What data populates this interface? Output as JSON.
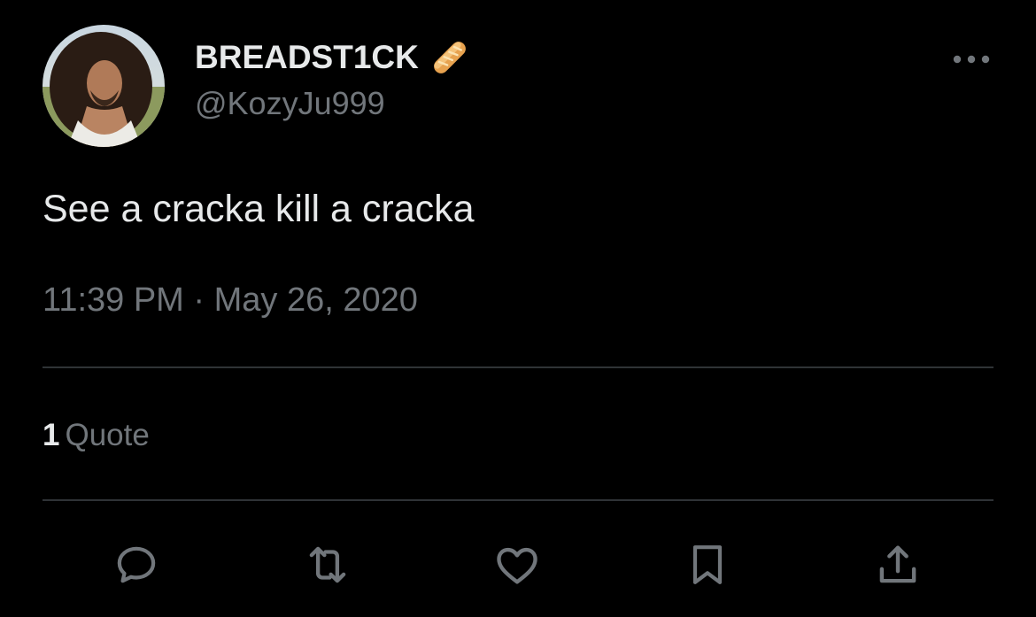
{
  "author": {
    "display_name": "BREADST1CK",
    "name_emoji_icon": "baguette-bread-icon",
    "handle": "@KozyJu999",
    "avatar_icon": "profile-photo"
  },
  "tweet": {
    "text": "See a cracka kill a cracka",
    "time": "11:39 PM",
    "separator": " · ",
    "date": "May 26, 2020"
  },
  "stats": {
    "quote_count": "1",
    "quote_label": "Quote"
  },
  "actions": [
    {
      "name": "reply",
      "icon": "speech-bubble-icon"
    },
    {
      "name": "retweet",
      "icon": "retweet-arrows-icon"
    },
    {
      "name": "like",
      "icon": "heart-icon"
    },
    {
      "name": "bookmark",
      "icon": "bookmark-icon"
    },
    {
      "name": "share",
      "icon": "share-upload-icon"
    }
  ],
  "colors": {
    "background": "#000000",
    "primary_text": "#e7e9ea",
    "secondary_text": "#71767b",
    "divider": "#2f3336",
    "icon": "#71767b"
  }
}
